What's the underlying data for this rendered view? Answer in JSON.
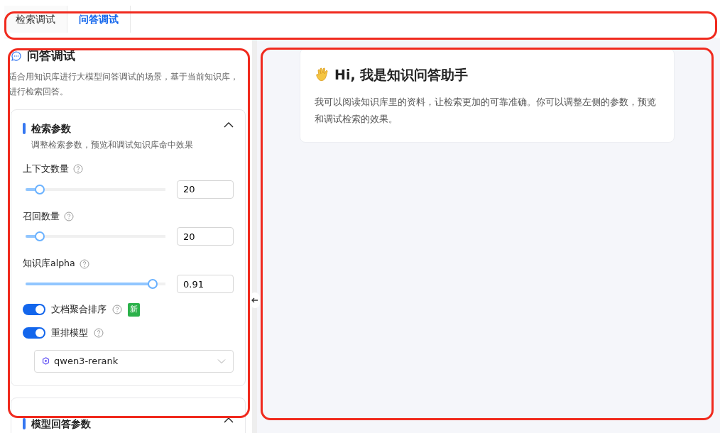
{
  "tabs": [
    {
      "label": "检索调试",
      "selected": false
    },
    {
      "label": "问答调试",
      "selected": true
    }
  ],
  "panel": {
    "title": "问答调试",
    "description": "适合用知识库进行大模型问答调试的场景，基于当前知识库，进行检索回答。"
  },
  "sections": [
    {
      "title": "检索参数",
      "subtitle": "调整检索参数，预览和调试知识库命中效果",
      "expanded": true,
      "params": [
        {
          "kind": "slider",
          "label": "上下文数量",
          "level": 0.1,
          "value": "20"
        },
        {
          "kind": "slider",
          "label": "召回数量",
          "level": 0.1,
          "value": "20"
        },
        {
          "kind": "slider",
          "label": "知识库alpha",
          "level": 0.91,
          "value": "0.91"
        },
        {
          "kind": "toggle",
          "label": "文档聚合排序",
          "on": true,
          "badge": "新"
        },
        {
          "kind": "toggle",
          "label": "重排模型",
          "on": true
        }
      ],
      "select": {
        "value": "qwen3-rerank"
      }
    },
    {
      "title": "模型回答参数",
      "expanded": true
    }
  ],
  "chat": {
    "greeting": "Hi, 我是知识问答助手",
    "message": "我可以阅读知识库里的资料，让检索更加的可靠准确。你可以调整左侧的参数，预览和调试检索的效果。"
  }
}
